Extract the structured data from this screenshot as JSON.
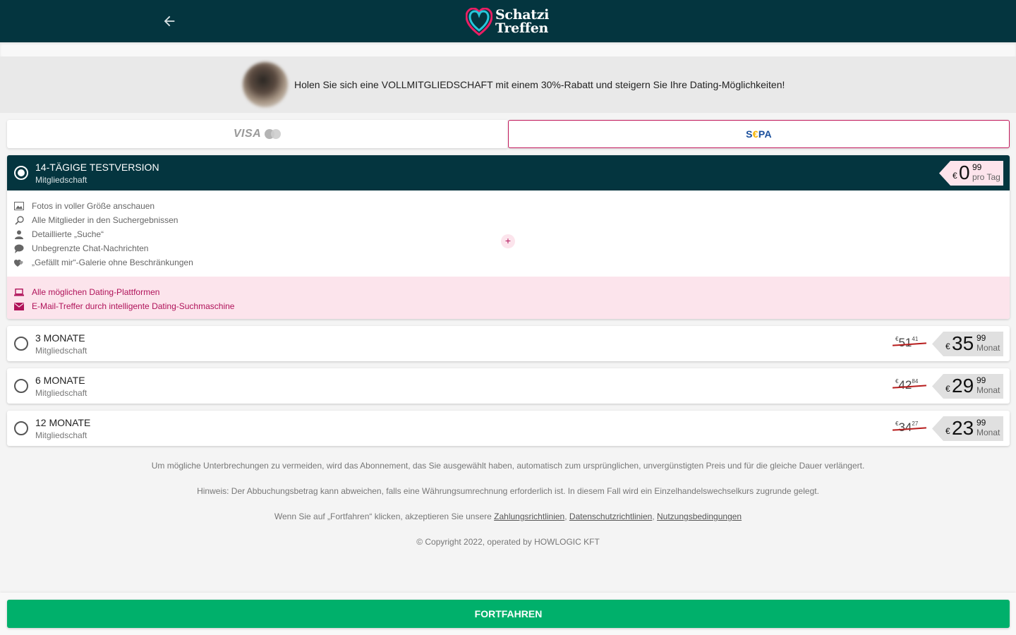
{
  "header": {
    "logo_line1": "Schatzi",
    "logo_line2": "Treffen",
    "back_icon": "arrow-left-icon",
    "logo_icon": "heart-icon",
    "background": "#04353f"
  },
  "promo": {
    "text": "Holen Sie sich eine VOLLMITGLIEDSCHAFT mit einem 30%-Rabatt und steigern Sie Ihre Dating-Möglichkeiten!"
  },
  "payment_methods": {
    "visa_label": "VISA",
    "sepa_prefix": "S",
    "sepa_euro": "€",
    "sepa_suffix": "PA",
    "selected": "SEPA"
  },
  "plans": [
    {
      "title": "14-Tägige Testversion",
      "subtitle": "Mitgliedschaft",
      "selected": true,
      "currency": "€",
      "price_int": "0",
      "price_dec": "99",
      "period": "pro Tag",
      "features": [
        {
          "icon": "image-icon",
          "label": "Fotos in voller Größe anschauen"
        },
        {
          "icon": "search-icon",
          "label": "Alle Mitglieder in den Suchergebnissen"
        },
        {
          "icon": "person-icon",
          "label": "Detaillierte „Suche“"
        },
        {
          "icon": "chat-icon",
          "label": "Unbegrenzte Chat-Nachrichten"
        },
        {
          "icon": "hearts-icon",
          "label": "„Gefällt mir“-Galerie ohne Beschränkungen"
        }
      ],
      "extras": [
        {
          "icon": "laptop-icon",
          "label": "Alle möglichen Dating-Plattformen"
        },
        {
          "icon": "mail-icon",
          "label": "E-Mail-Treffer durch intelligente Dating-Suchmaschine"
        }
      ],
      "expand_label": "+"
    },
    {
      "title": "3 Monate",
      "subtitle": "Mitgliedschaft",
      "selected": false,
      "old_currency": "€",
      "old_int": "51",
      "old_dec": "41",
      "currency": "€",
      "price_int": "35",
      "price_dec": "99",
      "period": "Monat"
    },
    {
      "title": "6 Monate",
      "subtitle": "Mitgliedschaft",
      "selected": false,
      "old_currency": "€",
      "old_int": "42",
      "old_dec": "84",
      "currency": "€",
      "price_int": "29",
      "price_dec": "99",
      "period": "Monat"
    },
    {
      "title": "12 Monate",
      "subtitle": "Mitgliedschaft",
      "selected": false,
      "old_currency": "€",
      "old_int": "34",
      "old_dec": "27",
      "currency": "€",
      "price_int": "23",
      "price_dec": "99",
      "period": "Monat"
    }
  ],
  "notes": {
    "renewal": "Um mögliche Unterbrechungen zu vermeiden, wird das Abonnement, das Sie ausgewählt haben, automatisch zum ursprünglichen, unvergünstigten Preis und für die gleiche Dauer verlängert.",
    "currency_hint": "Hinweis: Der Abbuchungsbetrag kann abweichen, falls eine Währungsumrechnung erforderlich ist. In diesem Fall wird ein Einzelhandelswechselkurs zugrunde gelegt.",
    "terms_prefix": "Wenn Sie auf „Fortfahren“ klicken, akzeptieren Sie unsere",
    "link_payment": "Zahlungsrichtlinien",
    "link_privacy": "Datenschutzrichtlinien",
    "link_terms": "Nutzungsbedingungen",
    "separator": ",",
    "copyright": "© Copyright 2022, operated by HOWLOGIC KFT"
  },
  "footer": {
    "continue_label": "FORTFAHREN",
    "continue_color": "#00b06b"
  },
  "colors": {
    "accent_pink": "#c2185b",
    "dark_teal": "#04353f"
  }
}
